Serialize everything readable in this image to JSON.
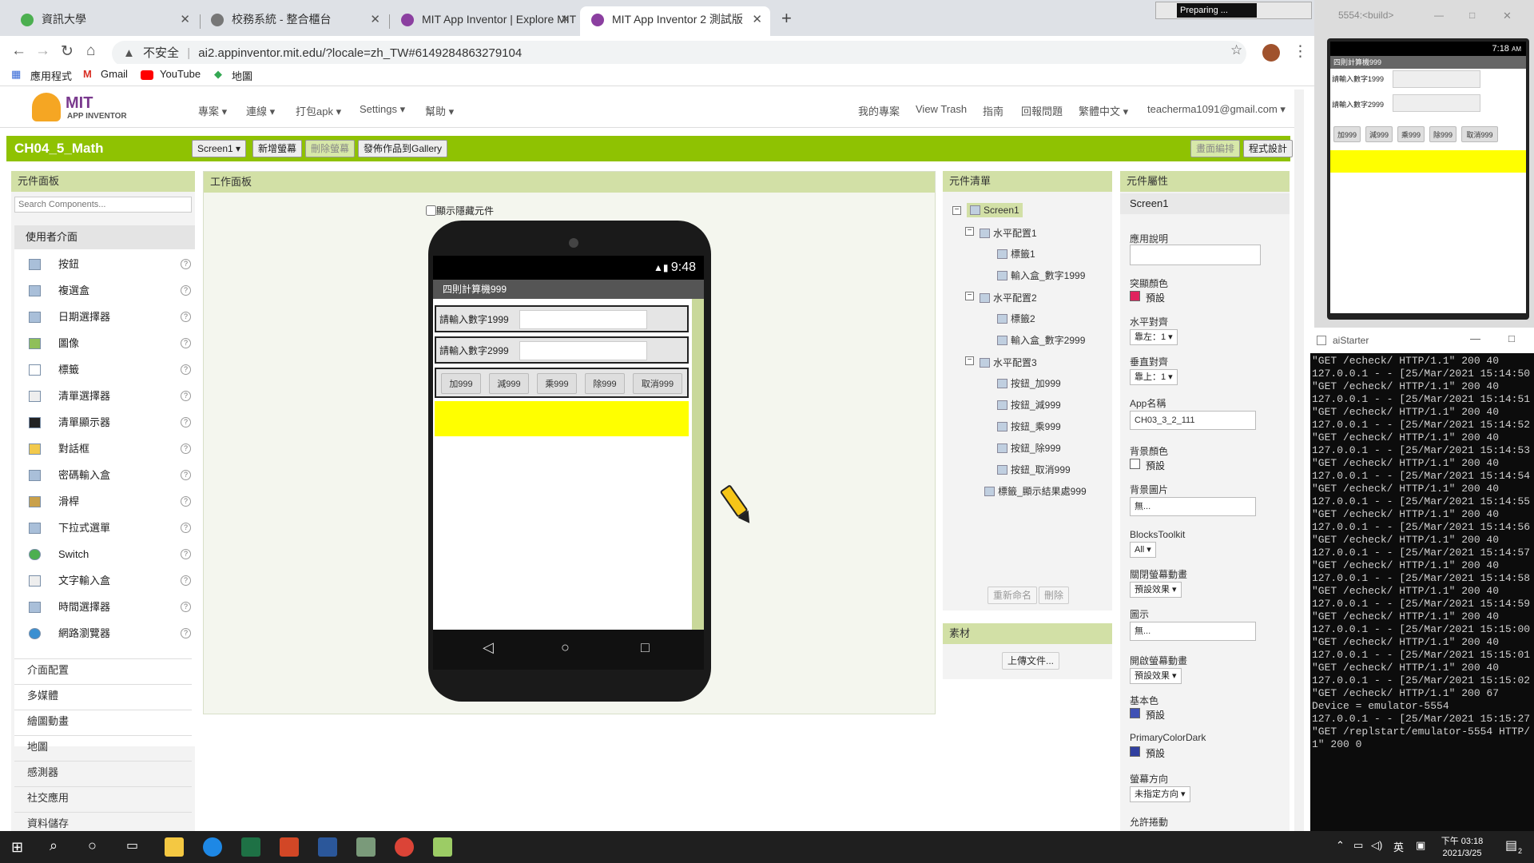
{
  "browser": {
    "tabs": [
      {
        "label": "資訊大學",
        "fav": "#4caf50"
      },
      {
        "label": "校務系統 - 整合櫃台",
        "fav": "#777777"
      },
      {
        "label": "MIT App Inventor | Explore MIT",
        "fav": "#8b3fa0"
      },
      {
        "label": "MIT App Inventor 2 測試版",
        "fav": "#8b3fa0"
      }
    ],
    "new_tab": "+",
    "url_warning": "不安全",
    "url": "ai2.appinventor.mit.edu/?locale=zh_TW#6149284863279104",
    "bookmarks": [
      "應用程式",
      "Gmail",
      "YouTube",
      "地圖"
    ],
    "recording_label": "Preparing ..."
  },
  "app_header": {
    "logo_main": "MIT",
    "logo_sub": "APP INVENTOR",
    "menus_left": [
      "專案",
      "連線",
      "打包apk",
      "Settings",
      "幫助"
    ],
    "menus_right": [
      "我的專案",
      "View Trash",
      "指南",
      "回報問題",
      "繁體中文",
      "teacherma1091@gmail.com"
    ]
  },
  "toolbar": {
    "project": "CH04_5_Math",
    "screen_select": "Screen1",
    "add_screen": "新增螢幕",
    "remove_screen": "刪除螢幕",
    "publish": "發佈作品到Gallery",
    "designer": "畫面編排",
    "blocks": "程式設計"
  },
  "palette": {
    "title": "元件面板",
    "search_placeholder": "Search Components...",
    "category_open": "使用者介面",
    "items": [
      "按鈕",
      "複選盒",
      "日期選擇器",
      "圖像",
      "標籤",
      "清單選擇器",
      "清單顯示器",
      "對話框",
      "密碼輸入盒",
      "滑桿",
      "下拉式選單",
      "Switch",
      "文字輸入盒",
      "時間選擇器",
      "網路瀏覽器"
    ],
    "categories": [
      "介面配置",
      "多媒體",
      "繪圖動畫",
      "地圖",
      "感測器",
      "社交應用",
      "資料儲存"
    ]
  },
  "viewer": {
    "title": "工作面板",
    "show_hidden": "顯示隱藏元件",
    "phone_time": "9:48",
    "app_title": "四則計算機999",
    "label1": "請輸入數字1999",
    "label2": "請輸入數字2999",
    "buttons": [
      "加999",
      "減999",
      "乘999",
      "除999",
      "取消999"
    ]
  },
  "components": {
    "title": "元件清單",
    "nodes": [
      {
        "label": "Screen1",
        "depth": 0
      },
      {
        "label": "水平配置1",
        "depth": 1
      },
      {
        "label": "標籤1",
        "depth": 2
      },
      {
        "label": "輸入盒_數字1999",
        "depth": 2
      },
      {
        "label": "水平配置2",
        "depth": 1
      },
      {
        "label": "標籤2",
        "depth": 2
      },
      {
        "label": "輸入盒_數字2999",
        "depth": 2
      },
      {
        "label": "水平配置3",
        "depth": 1
      },
      {
        "label": "按鈕_加999",
        "depth": 2
      },
      {
        "label": "按鈕_減999",
        "depth": 2
      },
      {
        "label": "按鈕_乘999",
        "depth": 2
      },
      {
        "label": "按鈕_除999",
        "depth": 2
      },
      {
        "label": "按鈕_取消999",
        "depth": 2
      },
      {
        "label": "標籤_顯示結果處999",
        "depth": 1
      }
    ],
    "rename": "重新命名",
    "delete": "刪除",
    "media_title": "素材",
    "upload": "上傳文件..."
  },
  "properties": {
    "title": "元件屬性",
    "component": "Screen1",
    "about_label": "應用說明",
    "accent_label": "突顯顏色",
    "accent_value": "預設",
    "halign_label": "水平對齊",
    "halign_value": "靠左：1",
    "valign_label": "垂直對齊",
    "valign_value": "靠上：1",
    "appname_label": "App名稱",
    "appname_value": "CH03_3_2_111",
    "bgcolor_label": "背景顏色",
    "bgcolor_value": "預設",
    "bgimage_label": "背景圖片",
    "bgimage_value": "無...",
    "toolkit_label": "BlocksToolkit",
    "toolkit_value": "All",
    "close_anim_label": "關閉螢幕動畫",
    "close_anim_value": "預設效果",
    "icon_label": "圖示",
    "icon_value": "無...",
    "open_anim_label": "開啟螢幕動畫",
    "open_anim_value": "預設效果",
    "primary_label": "基本色",
    "primary_value": "預設",
    "primary_dark_label": "PrimaryColorDark",
    "primary_dark_value": "預設",
    "orient_label": "螢幕方向",
    "orient_value": "未指定方向",
    "scroll_label": "允許捲動"
  },
  "emulator": {
    "title": "5554:<build>",
    "time": "7:18",
    "ampm": "AM",
    "app_title": "四則計算機999",
    "label1": "請輸入數字1999",
    "label2": "請輸入數字2999",
    "buttons": [
      "加999",
      "減999",
      "乘999",
      "除999",
      "取消999"
    ]
  },
  "aistarter": {
    "title": "aiStarter",
    "log": "\"GET /echeck/ HTTP/1.1\" 200 40\n127.0.0.1 - - [25/Mar/2021 15:14:50\n\"GET /echeck/ HTTP/1.1\" 200 40\n127.0.0.1 - - [25/Mar/2021 15:14:51\n\"GET /echeck/ HTTP/1.1\" 200 40\n127.0.0.1 - - [25/Mar/2021 15:14:52\n\"GET /echeck/ HTTP/1.1\" 200 40\n127.0.0.1 - - [25/Mar/2021 15:14:53\n\"GET /echeck/ HTTP/1.1\" 200 40\n127.0.0.1 - - [25/Mar/2021 15:14:54\n\"GET /echeck/ HTTP/1.1\" 200 40\n127.0.0.1 - - [25/Mar/2021 15:14:55\n\"GET /echeck/ HTTP/1.1\" 200 40\n127.0.0.1 - - [25/Mar/2021 15:14:56\n\"GET /echeck/ HTTP/1.1\" 200 40\n127.0.0.1 - - [25/Mar/2021 15:14:57\n\"GET /echeck/ HTTP/1.1\" 200 40\n127.0.0.1 - - [25/Mar/2021 15:14:58\n\"GET /echeck/ HTTP/1.1\" 200 40\n127.0.0.1 - - [25/Mar/2021 15:14:59\n\"GET /echeck/ HTTP/1.1\" 200 40\n127.0.0.1 - - [25/Mar/2021 15:15:00\n\"GET /echeck/ HTTP/1.1\" 200 40\n127.0.0.1 - - [25/Mar/2021 15:15:01\n\"GET /echeck/ HTTP/1.1\" 200 40\n127.0.0.1 - - [25/Mar/2021 15:15:02\n\"GET /echeck/ HTTP/1.1\" 200 67\nDevice = emulator-5554\n127.0.0.1 - - [25/Mar/2021 15:15:27\n\"GET /replstart/emulator-5554 HTTP/\n1\" 200 0"
  },
  "taskbar": {
    "ime": "英",
    "time": "下午 03:18",
    "date": "2021/3/25",
    "notif_count": "2"
  },
  "colors": {
    "brand_green": "#8fc202",
    "panel_header": "#d2e0a6",
    "accent_swatch": "#e0245e",
    "primary_swatch": "#3f51b5",
    "primary_dark_swatch": "#303f9f"
  }
}
